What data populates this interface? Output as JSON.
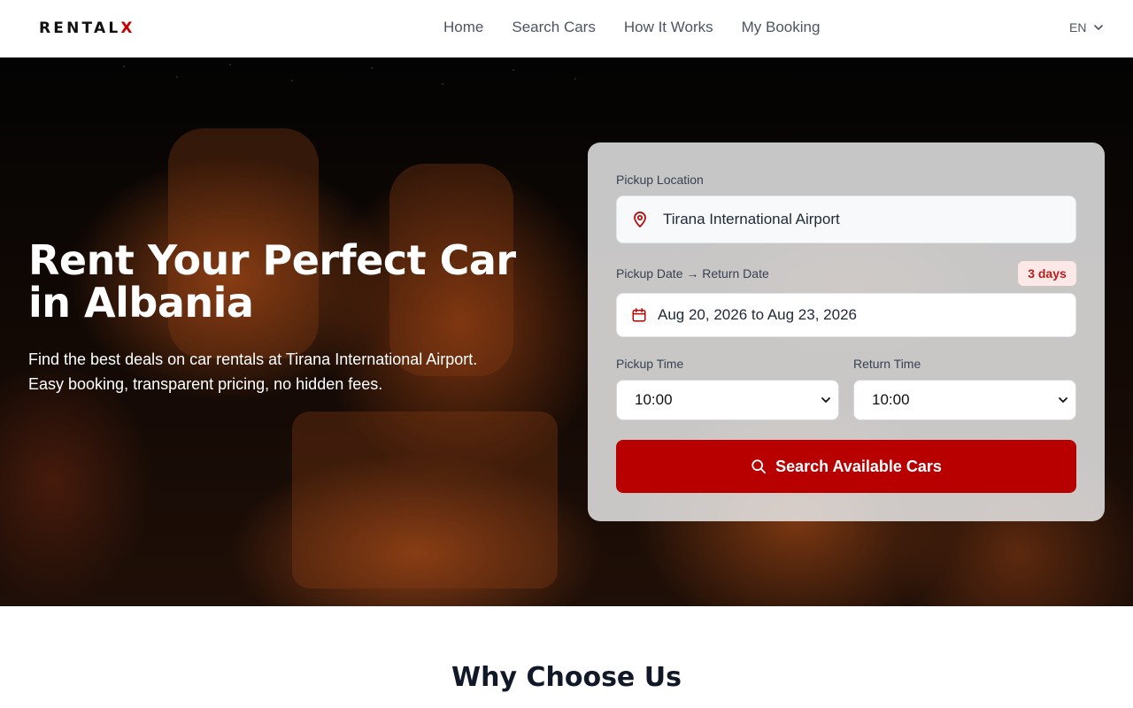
{
  "header": {
    "logo": {
      "main": "RENTAL",
      "accent": "X"
    },
    "nav": [
      "Home",
      "Search Cars",
      "How It Works",
      "My Booking"
    ],
    "language": "EN"
  },
  "hero": {
    "title": "Rent Your Perfect Car in Albania",
    "subtitle_line1": "Find the best deals on car rentals at Tirana International Airport.",
    "subtitle_line2": "Easy booking, transparent pricing, no hidden fees."
  },
  "search_form": {
    "pickup_location_label": "Pickup Location",
    "pickup_location_value": "Tirana International Airport",
    "dates_label": "Pickup Date → Return Date",
    "duration_badge": "3 days",
    "date_range_value": "Aug 20, 2026 to Aug 23, 2026",
    "pickup_time_label": "Pickup Time",
    "pickup_time_value": "10:00",
    "return_time_label": "Return Time",
    "return_time_value": "10:00",
    "submit_label": "Search Available Cars"
  },
  "sections": {
    "why_choose_us": "Why Choose Us"
  },
  "colors": {
    "brand": "#b80000",
    "badge_bg": "#fde8e8",
    "badge_text": "#b91c1c"
  },
  "icons": [
    "map-pin-icon",
    "calendar-icon",
    "chevron-down-icon",
    "search-icon"
  ]
}
